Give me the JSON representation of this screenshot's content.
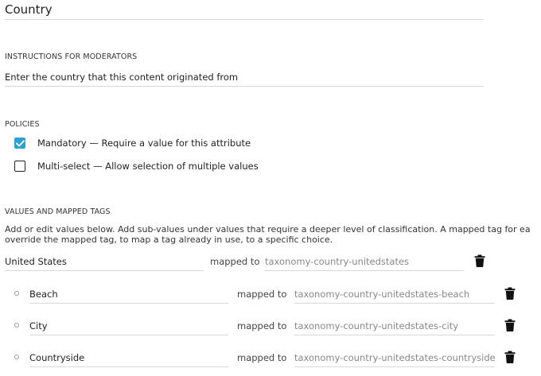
{
  "field": {
    "title_value": "Country"
  },
  "instructions": {
    "label": "INSTRUCTIONS FOR MODERATORS",
    "value": "Enter the country that this content originated from"
  },
  "policies": {
    "label": "POLICIES",
    "items": [
      {
        "label": "Mandatory — Require a value for this attribute",
        "checked": true
      },
      {
        "label": "Multi-select — Allow selection of multiple values",
        "checked": false
      }
    ]
  },
  "values": {
    "label": "VALUES AND MAPPED TAGS",
    "help_line1": "Add or edit values below. Add sub-values under values that require a deeper level of classification. A mapped tag for ea",
    "help_line2": "override the mapped tag, to map a tag already in use, to a specific choice.",
    "mapped_to_label": "mapped to",
    "parent": {
      "value": "United States",
      "tag": "taxonomy-country-unitedstates"
    },
    "children": [
      {
        "value": "Beach",
        "tag": "taxonomy-country-unitedstates-beach"
      },
      {
        "value": "City",
        "tag": "taxonomy-country-unitedstates-city"
      },
      {
        "value": "Countryside",
        "tag": "taxonomy-country-unitedstates-countryside"
      }
    ]
  },
  "colors": {
    "checkbox_checked": "#2aa3cf",
    "divider": "#d9d9d9"
  },
  "icons": {
    "check": "check-icon",
    "delete": "trash-icon",
    "bullet": "bullet-icon"
  }
}
